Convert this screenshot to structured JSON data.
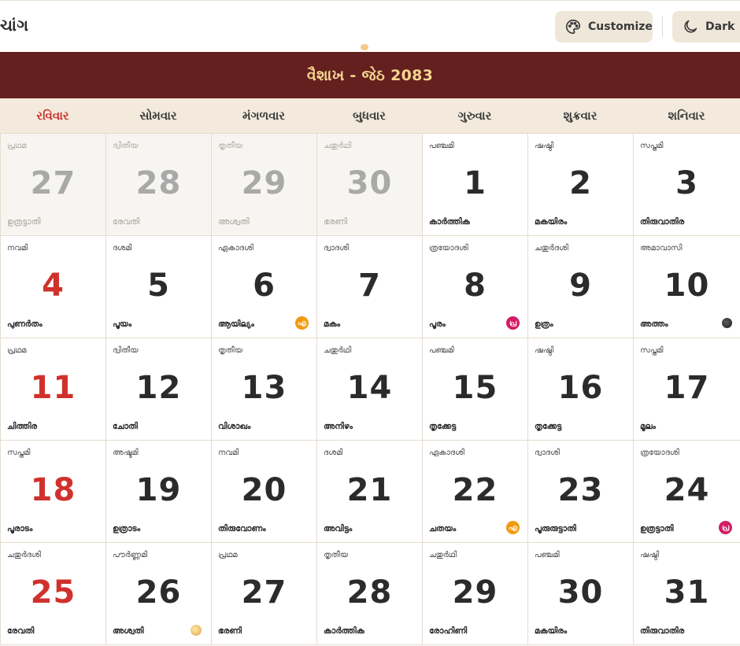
{
  "app": {
    "title": "ચાંગ"
  },
  "toolbar": {
    "customize_label": "Customize",
    "customize_icon": "palette-icon",
    "dark_label": "Dark",
    "dark_icon": "moon-icon"
  },
  "month": {
    "title": "વૈશાખ - જેઠ 2083"
  },
  "weekdays": [
    "રવિવાર",
    "સોમવાર",
    "મંગળવાર",
    "બુધવાર",
    "ગુરુવાર",
    "શુક્રવાર",
    "શનિવાર"
  ],
  "colors": {
    "header_bg": "#63201f",
    "header_text": "#f7d691",
    "sunday": "#d0312d",
    "weekday_bar": "#f3eadd",
    "button_bg": "#efe7d9"
  },
  "weeks": [
    [
      {
        "day": "27",
        "tithi": "പ്രഥമ",
        "nakshatra": "ഉത്രട്ടാതി",
        "muted": true
      },
      {
        "day": "28",
        "tithi": "ദ്വിതീയ",
        "nakshatra": "രേവതി",
        "muted": true
      },
      {
        "day": "29",
        "tithi": "തൃതീയ",
        "nakshatra": "അശ്വതി",
        "muted": true
      },
      {
        "day": "30",
        "tithi": "ചതുർഥി",
        "nakshatra": "ഭരണി",
        "muted": true
      },
      {
        "day": "1",
        "tithi": "പഞ്ചമി",
        "nakshatra": "കാർത്തിക"
      },
      {
        "day": "2",
        "tithi": "ഷഷ്ഠി",
        "nakshatra": "മകയിരം"
      },
      {
        "day": "3",
        "tithi": "സപ്തമി",
        "nakshatra": "തിരുവാതിര"
      }
    ],
    [
      {
        "day": "4",
        "tithi": "നവമി",
        "nakshatra": "പുണർതം"
      },
      {
        "day": "5",
        "tithi": "ദശമി",
        "nakshatra": "പൂയം"
      },
      {
        "day": "6",
        "tithi": "ഏകാദശി",
        "nakshatra": "ആയില്യം",
        "badge": "orange",
        "badge_text": "എ"
      },
      {
        "day": "7",
        "tithi": "ദ്വാദശി",
        "nakshatra": "മകം"
      },
      {
        "day": "8",
        "tithi": "ത്രയോദശി",
        "nakshatra": "പൂരം",
        "badge": "magenta",
        "badge_text": "പ്ര"
      },
      {
        "day": "9",
        "tithi": "ചതുർദശി",
        "nakshatra": "ഉത്രം"
      },
      {
        "day": "10",
        "tithi": "അമാവാസി",
        "nakshatra": "അത്തം",
        "badge": "newmoon",
        "badge_text": ""
      }
    ],
    [
      {
        "day": "11",
        "tithi": "പ്രഥമ",
        "nakshatra": "ചിത്തിര"
      },
      {
        "day": "12",
        "tithi": "ദ്വിതീയ",
        "nakshatra": "ചോതി"
      },
      {
        "day": "13",
        "tithi": "തൃതീയ",
        "nakshatra": "വിശാഖം"
      },
      {
        "day": "14",
        "tithi": "ചതുർഥി",
        "nakshatra": "അനിഴം"
      },
      {
        "day": "15",
        "tithi": "പഞ്ചമി",
        "nakshatra": "തൃക്കേട്ട"
      },
      {
        "day": "16",
        "tithi": "ഷഷ്ഠി",
        "nakshatra": "തൃക്കേട്ട"
      },
      {
        "day": "17",
        "tithi": "സപ്തമി",
        "nakshatra": "മൂലം"
      }
    ],
    [
      {
        "day": "18",
        "tithi": "സപ്തമി",
        "nakshatra": "പൂരാടം"
      },
      {
        "day": "19",
        "tithi": "അഷ്ടമി",
        "nakshatra": "ഉത്രാടം"
      },
      {
        "day": "20",
        "tithi": "നവമി",
        "nakshatra": "തിരുവോണം"
      },
      {
        "day": "21",
        "tithi": "ദശമി",
        "nakshatra": "അവിട്ടം"
      },
      {
        "day": "22",
        "tithi": "ഏകാദശി",
        "nakshatra": "ചതയം",
        "badge": "orange",
        "badge_text": "എ"
      },
      {
        "day": "23",
        "tithi": "ദ്വാദശി",
        "nakshatra": "പൂരുരുട്ടാതി"
      },
      {
        "day": "24",
        "tithi": "ത്രയോദശി",
        "nakshatra": "ഉത്രട്ടാതി",
        "badge": "magenta",
        "badge_text": "പ്ര"
      }
    ],
    [
      {
        "day": "25",
        "tithi": "ചതുർദശി",
        "nakshatra": "രേവതി"
      },
      {
        "day": "26",
        "tithi": "പൗർണ്ണമി",
        "nakshatra": "അശ്വതി",
        "badge": "fullmoon",
        "badge_text": ""
      },
      {
        "day": "27",
        "tithi": "പ്രഥമ",
        "nakshatra": "ഭരണി"
      },
      {
        "day": "28",
        "tithi": "തൃതീയ",
        "nakshatra": "കാർത്തിക"
      },
      {
        "day": "29",
        "tithi": "ചതുർഥി",
        "nakshatra": "രോഹിണി"
      },
      {
        "day": "30",
        "tithi": "പഞ്ചമി",
        "nakshatra": "മകയിരം"
      },
      {
        "day": "31",
        "tithi": "ഷഷ്ഠി",
        "nakshatra": "തിരുവാതിര"
      }
    ]
  ]
}
